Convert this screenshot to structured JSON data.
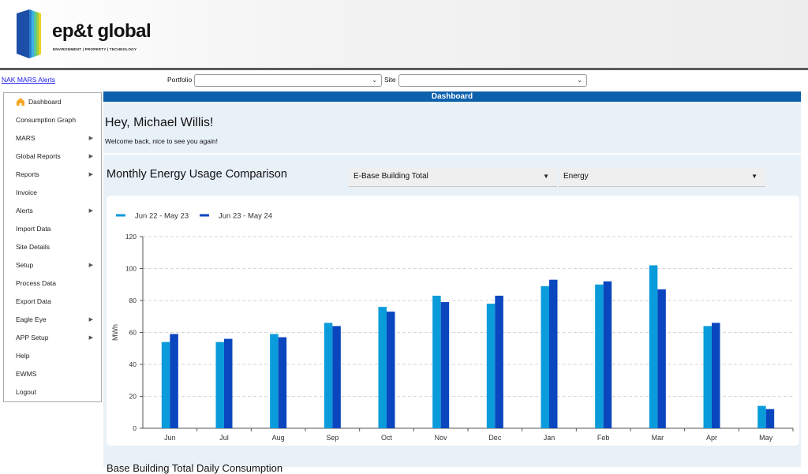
{
  "brand": {
    "name": "ep&t global",
    "tagline": "ENVIRONMENT | PROPERTY | TECHNOLOGY"
  },
  "topbar": {
    "alerts_link": "NAK MARS Alerts",
    "portfolio_label": "Portfolio",
    "site_label": "Site",
    "portfolio_value": "",
    "site_value": ""
  },
  "sidebar": {
    "items": [
      {
        "label": "Dashboard",
        "icon": "home-icon",
        "active": true,
        "submenu": false
      },
      {
        "label": "Consumption Graph",
        "submenu": false
      },
      {
        "label": "MARS",
        "submenu": true
      },
      {
        "label": "Global Reports",
        "submenu": true
      },
      {
        "label": "Reports",
        "submenu": true
      },
      {
        "label": "Invoice",
        "submenu": false
      },
      {
        "label": "Alerts",
        "submenu": true
      },
      {
        "label": "Import Data",
        "submenu": false
      },
      {
        "label": "Site Details",
        "submenu": false
      },
      {
        "label": "Setup",
        "submenu": true
      },
      {
        "label": "Process Data",
        "submenu": false
      },
      {
        "label": "Export Data",
        "submenu": false
      },
      {
        "label": "Eagle Eye",
        "submenu": true
      },
      {
        "label": "APP Setup",
        "submenu": true
      },
      {
        "label": "Help",
        "submenu": false
      },
      {
        "label": "EWMS",
        "submenu": false
      },
      {
        "label": "Logout",
        "submenu": false
      }
    ]
  },
  "main": {
    "bar_title": "Dashboard",
    "greeting": "Hey, Michael Willis!",
    "welcome_text": "Welcome back, nice to see you again!",
    "chart_title": "Monthly Energy Usage Comparison",
    "building_dropdown": "E-Base Building Total",
    "metric_dropdown": "Energy",
    "next_section_title": "Base Building Total Daily Consumption"
  },
  "colors": {
    "accent": "#0c61ad",
    "series1": "#0a9bdb",
    "series2": "#0a47bf",
    "home_icon": "#f5a623"
  },
  "chart_data": {
    "type": "bar",
    "categories": [
      "Jun",
      "Jul",
      "Aug",
      "Sep",
      "Oct",
      "Nov",
      "Dec",
      "Jan",
      "Feb",
      "Mar",
      "Apr",
      "May"
    ],
    "series": [
      {
        "name": "Jun 22 - May 23",
        "values": [
          54,
          54,
          59,
          66,
          76,
          83,
          78,
          89,
          90,
          102,
          64,
          14
        ]
      },
      {
        "name": "Jun 23 - May 24",
        "values": [
          59,
          56,
          57,
          64,
          73,
          79,
          83,
          93,
          92,
          87,
          66,
          12
        ]
      }
    ],
    "ylabel": "MWh",
    "ylim": [
      0,
      120
    ],
    "yticks": [
      0,
      20,
      40,
      60,
      80,
      100,
      120
    ],
    "grid": true,
    "legend": "top-left"
  }
}
